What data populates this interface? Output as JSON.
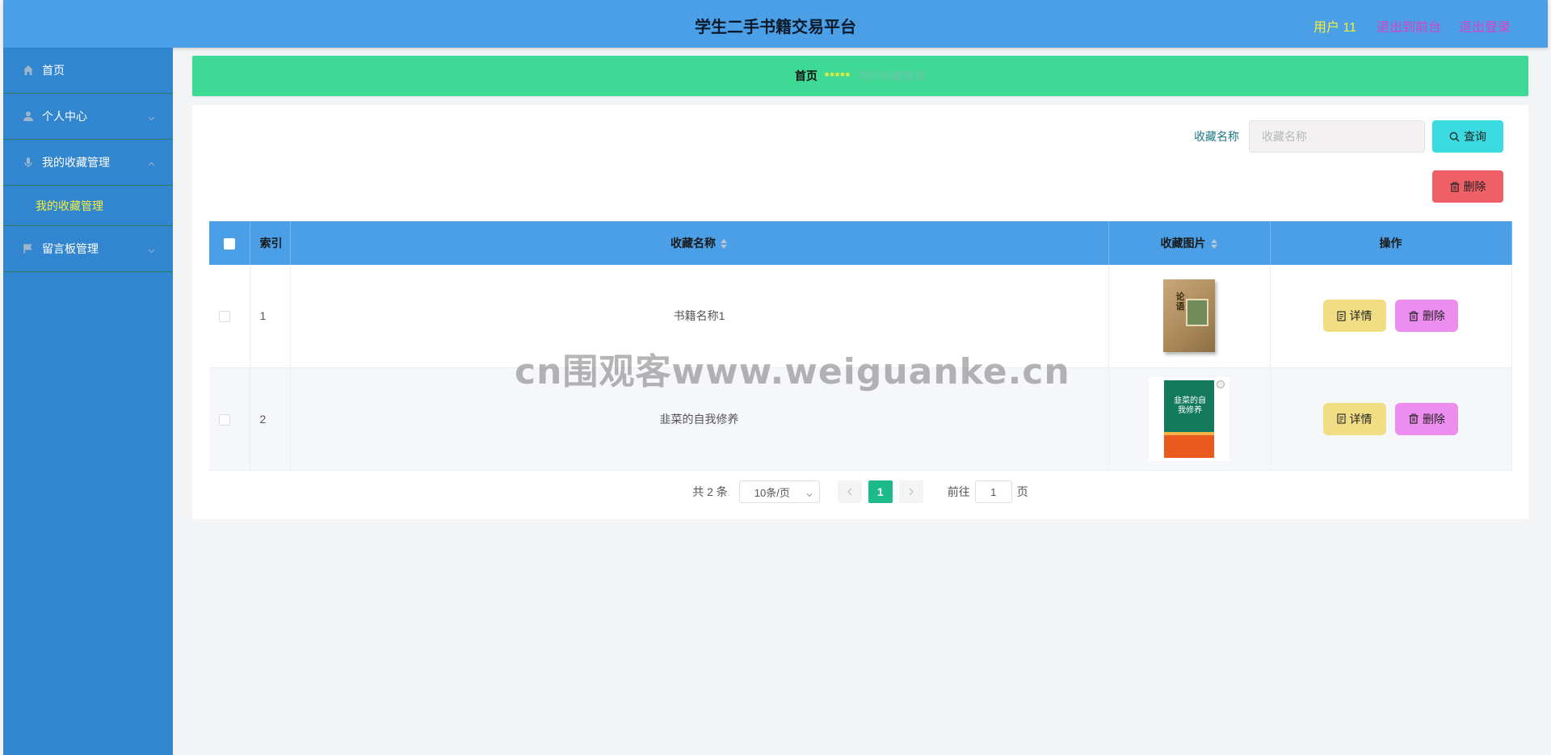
{
  "header": {
    "title": "学生二手书籍交易平台",
    "user": "用户 11",
    "to_front": "退出到前台",
    "logout": "退出登录"
  },
  "sidebar": {
    "items": [
      {
        "label": "首页",
        "icon": "home-icon"
      },
      {
        "label": "个人中心",
        "icon": "user-icon",
        "expanded": false
      },
      {
        "label": "我的收藏管理",
        "icon": "microphone-icon",
        "expanded": true,
        "children": [
          "我的收藏管理"
        ]
      },
      {
        "label": "留言板管理",
        "icon": "flag-icon",
        "expanded": false
      }
    ]
  },
  "breadcrumb": {
    "home": "首页",
    "separator": "*****",
    "current": "我的收藏管理"
  },
  "search": {
    "label": "收藏名称",
    "placeholder": "收藏名称",
    "query_button": "查询",
    "delete_button": "删除"
  },
  "table": {
    "columns": [
      "索引",
      "收藏名称",
      "收藏图片",
      "操作"
    ],
    "rows": [
      {
        "index": "1",
        "name": "书籍名称1",
        "cover_title": "论语"
      },
      {
        "index": "2",
        "name": "韭菜的自我修养",
        "cover_title": "韭菜的自我修养"
      }
    ],
    "detail_label": "详情",
    "delete_label": "删除"
  },
  "pagination": {
    "total": "共 2 条",
    "page_size": "10条/页",
    "current_page": "1",
    "goto_prefix": "前往",
    "goto_value": "1",
    "goto_suffix": "页"
  },
  "watermark": "cn围观客www.weiguanke.cn",
  "colors": {
    "header_bg": "#4a9fe6",
    "sidebar_bg": "#3286d0",
    "breadcrumb_bg": "#3ed995",
    "query_btn": "#3bd9e0",
    "delete_btn": "#ef5f66",
    "detail_btn": "#f0dd84",
    "row_delete_btn": "#ee8df0",
    "active_page": "#1dba8a"
  }
}
